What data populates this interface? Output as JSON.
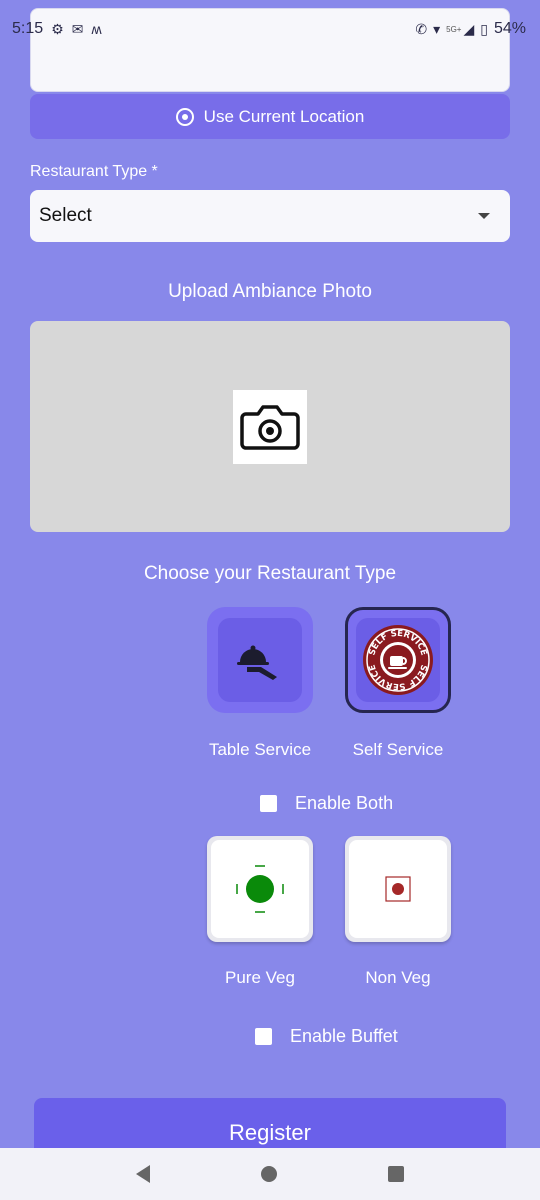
{
  "status_bar": {
    "time": "5:15",
    "left_icons": [
      "settings-icon",
      "gmail-icon",
      "m-app-icon"
    ],
    "network_tag": "5G+",
    "battery": "54%"
  },
  "location": {
    "address_value": "",
    "use_current_location_label": "Use Current Location"
  },
  "restaurant_type_field": {
    "label": "Restaurant Type *",
    "selected_value": "Select"
  },
  "upload": {
    "title": "Upload Ambiance Photo",
    "icon": "camera-icon"
  },
  "service_type": {
    "title": "Choose your Restaurant Type",
    "options": [
      {
        "label": "Table Service",
        "icon": "cloche-hand-icon",
        "selected": false
      },
      {
        "label": "Self Service",
        "icon": "self-service-badge-icon",
        "badge_text": "SELF SERVICE",
        "selected": true
      }
    ],
    "enable_both_label": "Enable Both",
    "enable_both_checked": false
  },
  "diet_type": {
    "options": [
      {
        "label": "Pure Veg",
        "icon": "veg-symbol-icon",
        "color": "#0a8a0a"
      },
      {
        "label": "Non Veg",
        "icon": "non-veg-symbol-icon",
        "color": "#a52828"
      }
    ],
    "enable_buffet_label": "Enable Buffet",
    "enable_buffet_checked": false
  },
  "register_label": "Register",
  "colors": {
    "background": "#8888ea",
    "accent": "#786de9",
    "button": "#6a60ea"
  },
  "nav": [
    "back-icon",
    "home-icon",
    "recents-icon"
  ]
}
